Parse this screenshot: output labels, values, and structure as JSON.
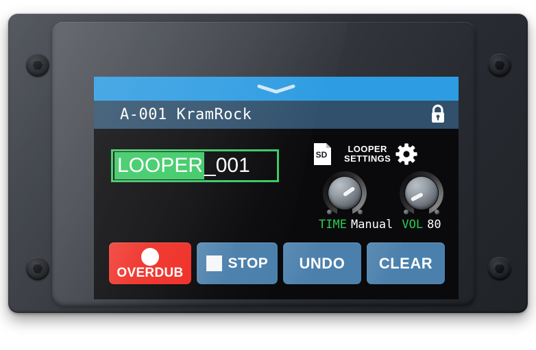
{
  "device": {
    "name": "looper-pedal-touchscreen",
    "chassis_color": "#2f3238",
    "bezel_color": "#33363c",
    "screw_count": 4
  },
  "screen": {
    "background": "#0a0a0c",
    "drag_bar": {
      "color": "#2d9ce2",
      "handle_icon": "chevron-down-icon"
    },
    "title_bar": {
      "color": "#30506c",
      "preset_title": "A-001 KramRock",
      "lock_icon": "padlock-unlocked-icon",
      "lock_state": "unlocked"
    },
    "looper_name": {
      "selected_text": "LOOPER",
      "remaining_text": "_001",
      "full_value": "LOOPER_001",
      "border_color": "#3bc965",
      "selection_color": "#3bc965"
    },
    "settings_header": {
      "sd_icon_label": "SD",
      "title_line1": "LOOPER",
      "title_line2": "SETTINGS",
      "gear_icon": "gear-icon"
    },
    "knobs": [
      {
        "id": "time",
        "label": "TIME",
        "value": "Manual",
        "angle_deg": -125,
        "label_color": "#2ecc52"
      },
      {
        "id": "vol",
        "label": "VOL",
        "value": "80",
        "angle_deg": 62,
        "label_color": "#2ecc52"
      }
    ],
    "transport_buttons": [
      {
        "id": "overdub",
        "label": "OVERDUB",
        "icon": "record-circle-icon",
        "color": "#ef2b22"
      },
      {
        "id": "stop",
        "label": "STOP",
        "icon": "stop-square-icon",
        "color": "#4b80ac"
      },
      {
        "id": "undo",
        "label": "UNDO",
        "icon": "",
        "color": "#4b80ac"
      },
      {
        "id": "clear",
        "label": "CLEAR",
        "icon": "",
        "color": "#4b80ac"
      }
    ]
  }
}
